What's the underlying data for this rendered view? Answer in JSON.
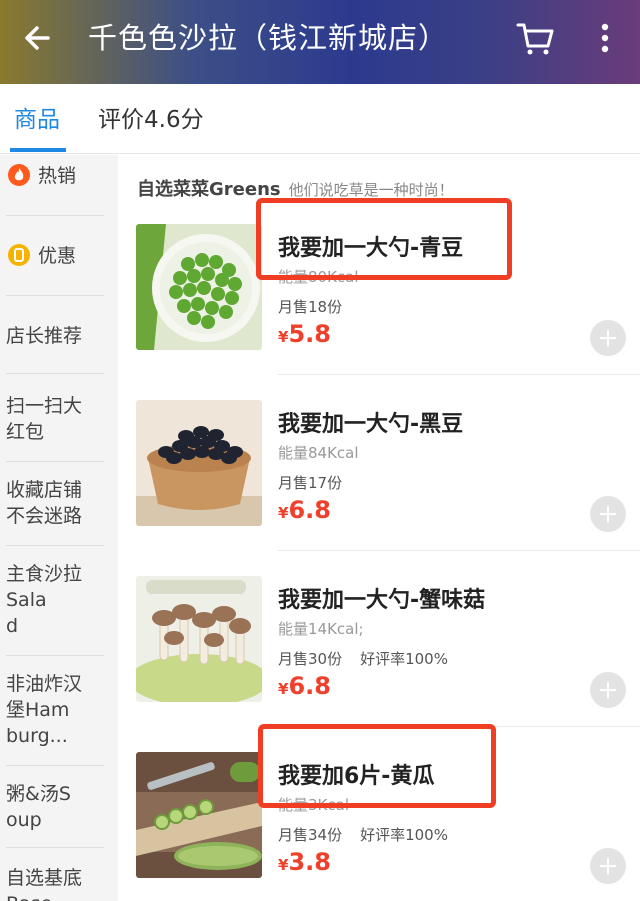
{
  "header": {
    "title": "千色色沙拉（钱江新城店）",
    "back_icon": "back-arrow-icon",
    "cart_icon": "cart-icon",
    "more_icon": "more-vertical-icon"
  },
  "tabs": [
    {
      "label": "商品",
      "active": true
    },
    {
      "label": "评价4.6分",
      "active": false
    }
  ],
  "sidebar": {
    "items": [
      {
        "label": "热销",
        "icon": "flame-icon"
      },
      {
        "label": "优惠",
        "icon": "coupon-icon"
      },
      {
        "label": "店长推荐"
      },
      {
        "line1": "扫一扫大",
        "line2": "红包"
      },
      {
        "line1": "收藏店铺",
        "line2": "不会迷路"
      },
      {
        "line1": "主食沙拉",
        "line2": "Sala",
        "line3": "d"
      },
      {
        "line1": "非油炸汉",
        "line2": "堡Ham",
        "line3": "burg..."
      },
      {
        "line1": "粥&汤S",
        "line2": "oup"
      },
      {
        "line1": "自选基底",
        "line2": "Base"
      }
    ]
  },
  "section": {
    "title": "自选菜菜Greens",
    "subtitle": "他们说吃草是一种时尚！"
  },
  "items": [
    {
      "name": "我要加一大勺-青豆",
      "kcal": "能量80Kcal",
      "sales": "月售18份",
      "rating": "",
      "yen": "¥",
      "price": "5.8"
    },
    {
      "name": "我要加一大勺-黑豆",
      "kcal": "能量84Kcal",
      "sales": "月售17份",
      "rating": "",
      "yen": "¥",
      "price": "6.8"
    },
    {
      "name": "我要加一大勺-蟹味菇",
      "kcal": "能量14Kcal;",
      "sales": "月售30份",
      "rating": "好评率100%",
      "yen": "¥",
      "price": "6.8"
    },
    {
      "name": "我要加6片-黄瓜",
      "kcal": "能量3Kcal",
      "sales": "月售34份",
      "rating": "好评率100%",
      "yen": "¥",
      "price": "3.8"
    }
  ],
  "colors": {
    "accent": "#1e88e5",
    "price": "#f0402c",
    "highlight": "#ef3e23"
  }
}
